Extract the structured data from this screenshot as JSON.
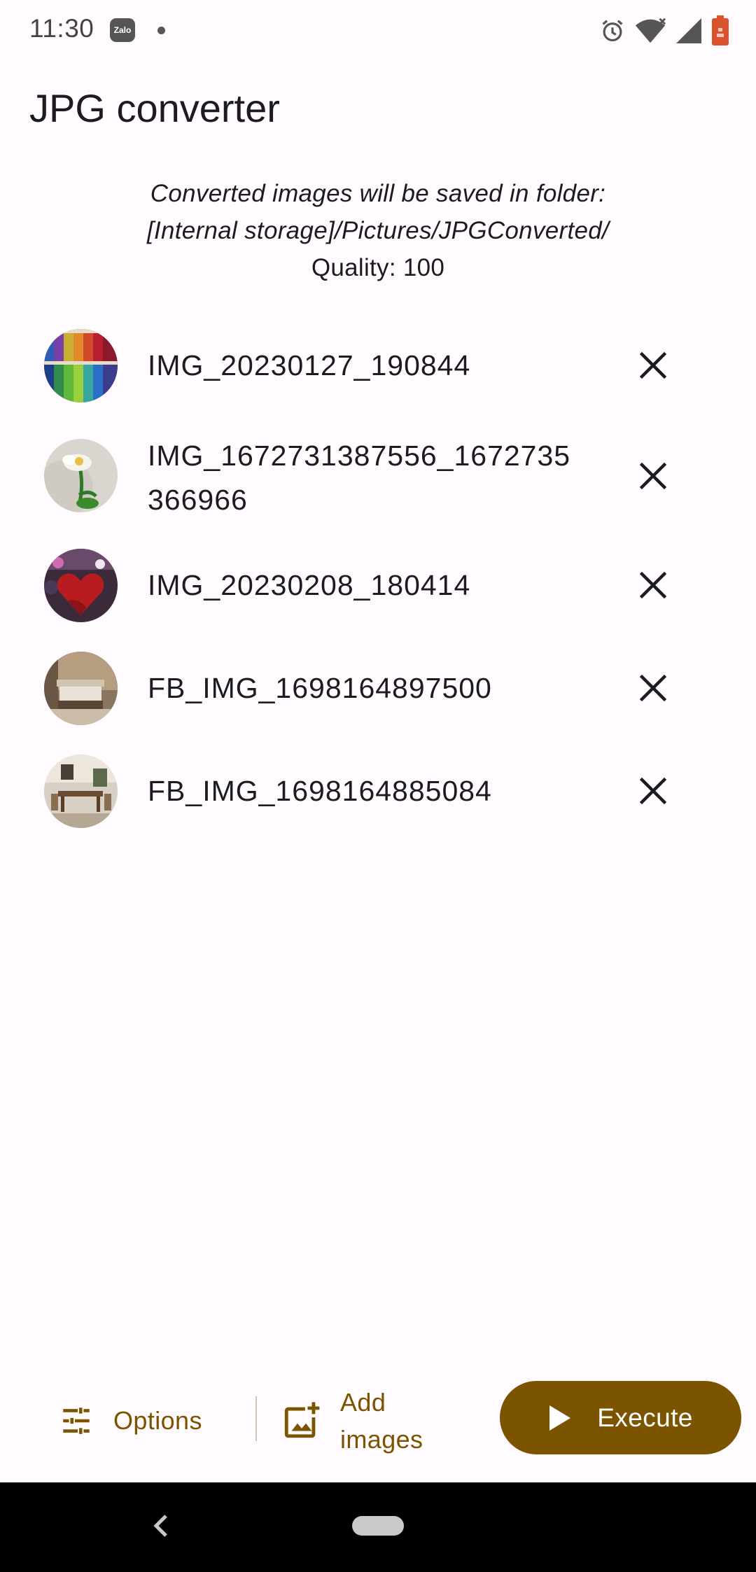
{
  "status_bar": {
    "time": "11:30",
    "notification_app": "Zalo",
    "icons": [
      "alarm-icon",
      "wifi-icon",
      "signal-icon",
      "battery-icon"
    ]
  },
  "app": {
    "title": "JPG converter"
  },
  "info": {
    "line1": "Converted images will be saved in folder:",
    "line2": "[Internal storage]/Pictures/JPGConverted/",
    "quality": "Quality: 100"
  },
  "files": [
    {
      "name": "IMG_20230127_190844",
      "thumb": "thread-spools"
    },
    {
      "name": "IMG_1672731387556_1672735366966",
      "thumb": "white-flower"
    },
    {
      "name": "IMG_20230208_180414",
      "thumb": "red-heart"
    },
    {
      "name": "FB_IMG_1698164897500",
      "thumb": "bedroom"
    },
    {
      "name": "FB_IMG_1698164885084",
      "thumb": "dining-room"
    }
  ],
  "actions": {
    "options_label": "Options",
    "add_images_label": "Add images",
    "execute_label": "Execute"
  },
  "colors": {
    "accent": "#7C5400",
    "background": "#FFFBFE",
    "text": "#1C1B1F"
  }
}
